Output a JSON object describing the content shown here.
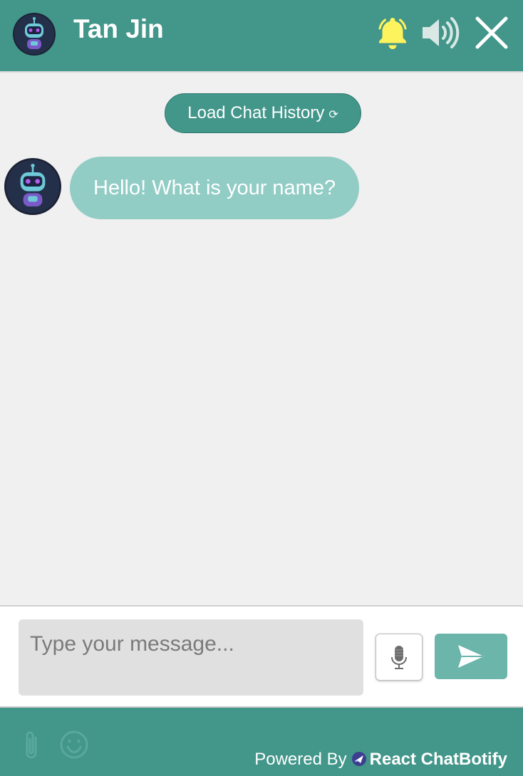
{
  "header": {
    "title": "Tan Jin",
    "avatar_icon": "robot-avatar-icon",
    "bell_icon": "bell-icon",
    "volume_icon": "volume-icon",
    "close_icon": "close-icon",
    "bell_color": "#fdf35c"
  },
  "chat": {
    "load_history_label": "Load Chat History",
    "load_history_icon": "⟳",
    "messages": [
      {
        "sender": "bot",
        "text": "Hello! What is your name?"
      }
    ]
  },
  "input": {
    "placeholder": "Type your message...",
    "mic_icon": "microphone-icon",
    "send_icon": "send-icon"
  },
  "footer": {
    "attach_icon": "paperclip-icon",
    "emoji_icon": "smiley-icon",
    "powered_by_label": "Powered By",
    "brand_name": "React ChatBotify"
  },
  "colors": {
    "primary": "#42968a",
    "bubble": "#91ccc5",
    "send": "#6bb5ab",
    "background": "#f0f0f0"
  }
}
